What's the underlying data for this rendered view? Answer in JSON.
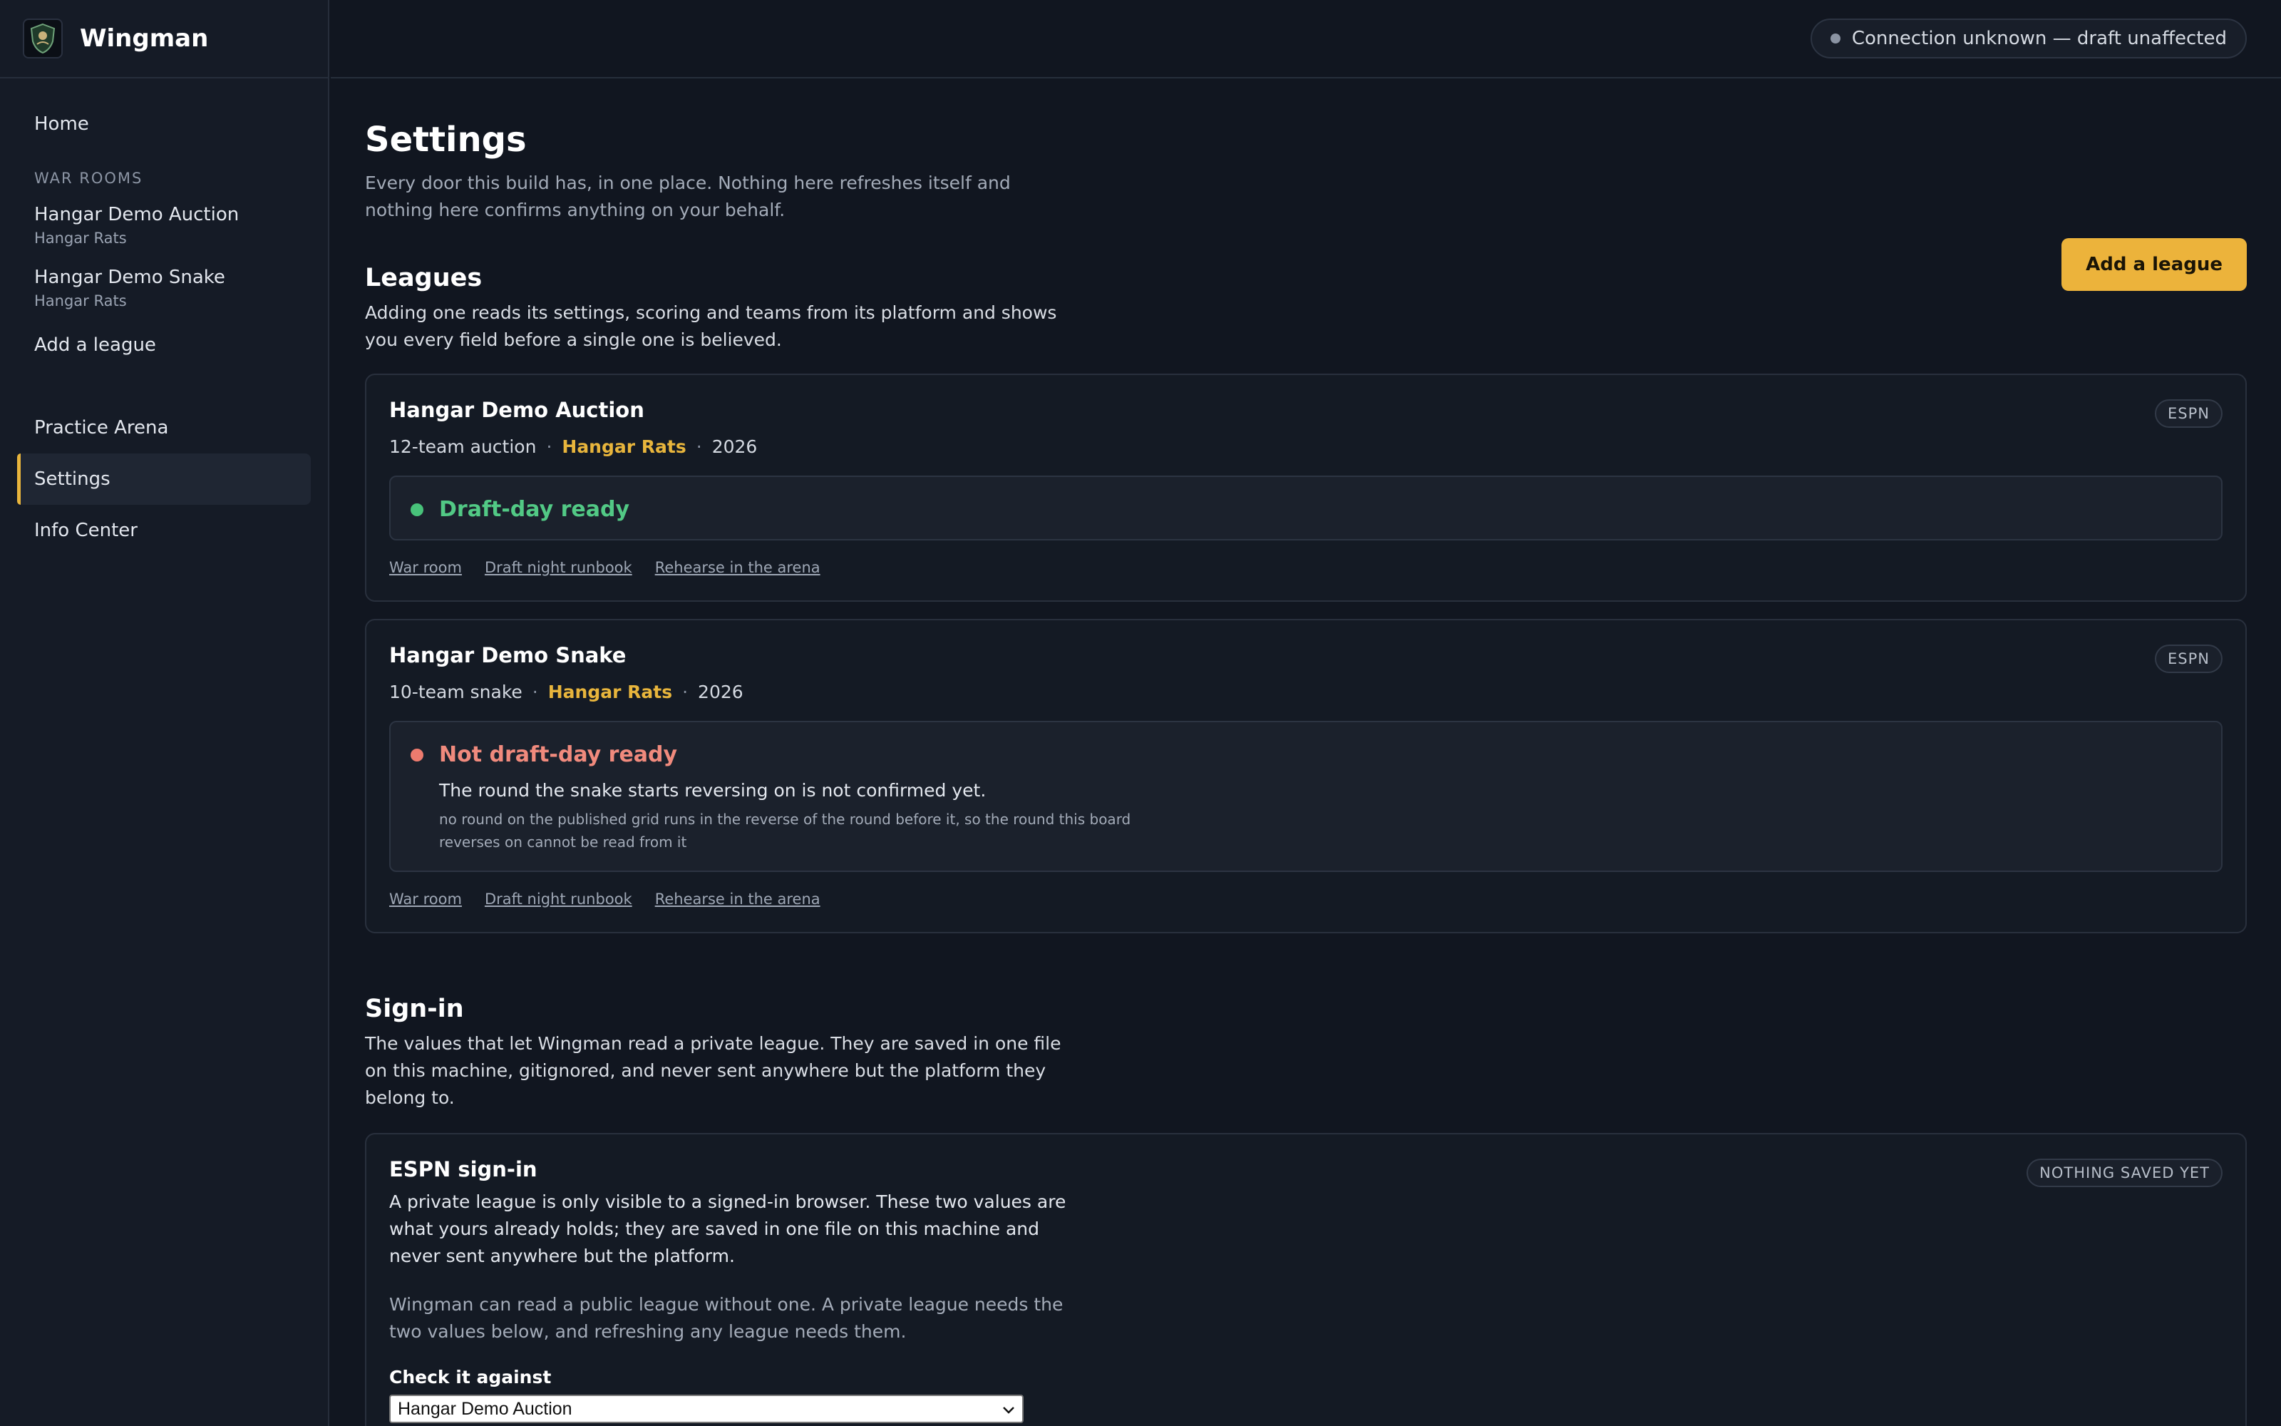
{
  "app": {
    "name": "Wingman"
  },
  "sidebar": {
    "home": "Home",
    "section_war_rooms": "WAR ROOMS",
    "war_rooms": [
      {
        "label": "Hangar Demo Auction",
        "sub": "Hangar Rats"
      },
      {
        "label": "Hangar Demo Snake",
        "sub": "Hangar Rats"
      }
    ],
    "add_league": "Add a league",
    "practice_arena": "Practice Arena",
    "settings": "Settings",
    "info_center": "Info Center"
  },
  "topbar": {
    "connection_status": "Connection unknown — draft unaffected"
  },
  "page": {
    "title": "Settings",
    "subtitle": "Every door this build has, in one place. Nothing here refreshes itself and nothing here confirms anything on your behalf."
  },
  "leagues": {
    "title": "Leagues",
    "subtitle": "Adding one reads its settings, scoring and teams from its platform and shows you every field before a single one is believed.",
    "add_button": "Add a league",
    "cards": [
      {
        "title": "Hangar Demo Auction",
        "format": "12-team auction",
        "team": "Hangar Rats",
        "season": "2026",
        "platform": "ESPN",
        "status": "Draft-day ready",
        "links": [
          "War room",
          "Draft night runbook",
          "Rehearse in the arena"
        ]
      },
      {
        "title": "Hangar Demo Snake",
        "format": "10-team snake",
        "team": "Hangar Rats",
        "season": "2026",
        "platform": "ESPN",
        "status": "Not draft-day ready",
        "status_detail": "The round the snake starts reversing on is not confirmed yet.",
        "status_note": "no round on the published grid runs in the reverse of the round before it, so the round this board reverses on cannot be read from it",
        "links": [
          "War room",
          "Draft night runbook",
          "Rehearse in the arena"
        ]
      }
    ]
  },
  "signin": {
    "title": "Sign-in",
    "subtitle": "The values that let Wingman read a private league. They are saved in one file on this machine, gitignored, and never sent anywhere but the platform they belong to.",
    "espn": {
      "title": "ESPN sign-in",
      "badge": "NOTHING SAVED YET",
      "text": "A private league is only visible to a signed-in browser. These two values are what yours already holds; they are saved in one file on this machine and never sent anywhere but the platform.",
      "muted": "Wingman can read a public league without one. A private league needs the two values below, and refreshing any league needs them.",
      "check_label": "Check it against",
      "check_value": "Hangar Demo Auction"
    }
  }
}
